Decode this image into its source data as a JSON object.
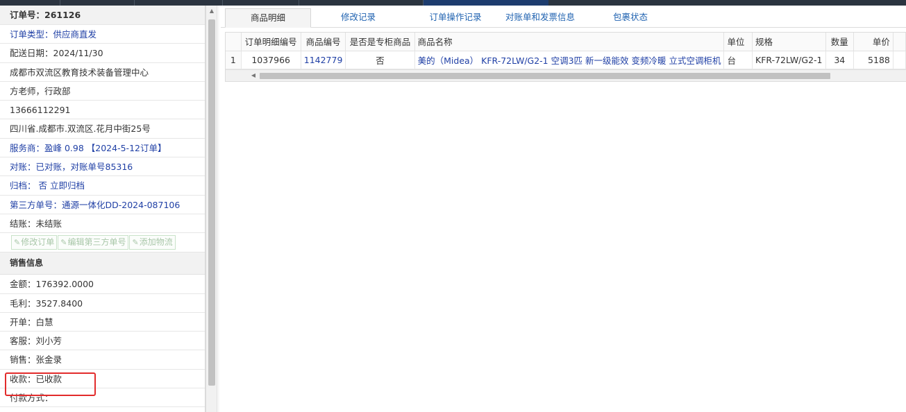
{
  "order": {
    "title": "订单号：261126",
    "rows": [
      {
        "text": "订单类型：供应商直发",
        "kind": "link"
      },
      {
        "text": "配送日期：2024/11/30",
        "kind": "plain"
      },
      {
        "text": "成都市双流区教育技术装备管理中心",
        "kind": "plain"
      },
      {
        "text": "方老师，行政部",
        "kind": "plain"
      },
      {
        "text": "13666112291",
        "kind": "plain"
      },
      {
        "text": "四川省.成都市.双流区.花月中街25号",
        "kind": "plain"
      },
      {
        "text": "服务商：盈峰 0.98 【2024-5-12订单】",
        "kind": "link"
      },
      {
        "text": "对账：已对账，对账单号85316",
        "kind": "link"
      },
      {
        "text": "归档：  否 立即归档",
        "kind": "link"
      },
      {
        "text": "第三方单号：通源一体化DD-2024-087106",
        "kind": "link"
      },
      {
        "text": "结账：未结账",
        "kind": "plain"
      }
    ],
    "buttons": {
      "edit_order": "修改订单",
      "edit_third_party": "编辑第三方单号",
      "add_logistics": "添加物流"
    }
  },
  "sales": {
    "title": "销售信息",
    "rows": [
      "金额：176392.0000",
      "毛利：3527.8400",
      "开单：白慧",
      "客服：刘小芳",
      "销售：张金录",
      "收款：已收款",
      "付款方式："
    ]
  },
  "tabs": [
    "商品明细",
    "修改记录",
    "订单操作记录",
    "对账单和发票信息",
    "包裹状态"
  ],
  "table": {
    "headers": [
      "订单明细编号",
      "商品编号",
      "是否是专柜商品",
      "商品名称",
      "单位",
      "规格",
      "数量",
      "单价"
    ],
    "rows": [
      {
        "num": "1",
        "detail_id": "1037966",
        "product_id": "1142779",
        "is_counter": "否",
        "name": "美的（Midea） KFR-72LW/G2-1 空调3匹 新一级能效 变频冷暖 立式空调柜机",
        "unit": "台",
        "spec": "KFR-72LW/G2-1",
        "qty": "34",
        "price": "5188"
      }
    ]
  },
  "colors": {
    "link": "#1f3fa5",
    "highlight_box": "#e22b2b",
    "tab_text": "#1f62b0"
  }
}
